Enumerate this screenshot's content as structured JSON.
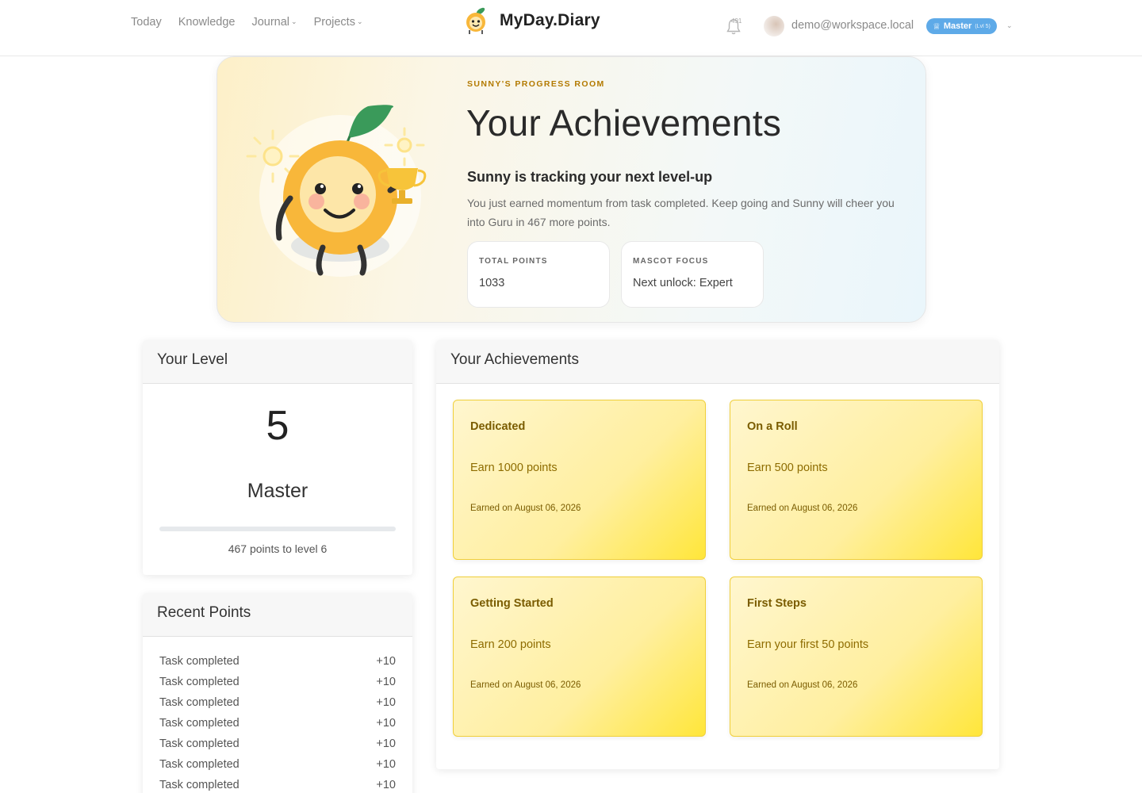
{
  "nav": {
    "links": [
      "Today",
      "Knowledge",
      "Journal",
      "Projects"
    ],
    "brand": "MyDay.Diary",
    "notification_count": "491",
    "user_email": "demo@workspace.local",
    "badge_label": "Master",
    "badge_level": "(Lvl 5)"
  },
  "hero": {
    "eyebrow": "SUNNY'S PROGRESS ROOM",
    "title": "Your Achievements",
    "subtitle": "Sunny is tracking your next level-up",
    "description": "You just earned momentum from task completed. Keep going and Sunny will cheer you into Guru in 467 more points.",
    "stats": [
      {
        "label": "TOTAL POINTS",
        "value": "1033"
      },
      {
        "label": "MASCOT FOCUS",
        "value": "Next unlock: Expert"
      }
    ]
  },
  "level_card": {
    "title": "Your Level",
    "level": "5",
    "name": "Master",
    "progress_fraction": 0.0,
    "note": "467 points to level 6"
  },
  "recent_points": {
    "title": "Recent Points",
    "items": [
      {
        "label": "Task completed",
        "points": "+10"
      },
      {
        "label": "Task completed",
        "points": "+10"
      },
      {
        "label": "Task completed",
        "points": "+10"
      },
      {
        "label": "Task completed",
        "points": "+10"
      },
      {
        "label": "Task completed",
        "points": "+10"
      },
      {
        "label": "Task completed",
        "points": "+10"
      },
      {
        "label": "Task completed",
        "points": "+10"
      }
    ]
  },
  "achievements": {
    "title": "Your Achievements",
    "items": [
      {
        "title": "Dedicated",
        "desc": "Earn 1000 points",
        "date": "Earned on August 06, 2026"
      },
      {
        "title": "On a Roll",
        "desc": "Earn 500 points",
        "date": "Earned on August 06, 2026"
      },
      {
        "title": "Getting Started",
        "desc": "Earn 200 points",
        "date": "Earned on August 06, 2026"
      },
      {
        "title": "First Steps",
        "desc": "Earn your first 50 points",
        "date": "Earned on August 06, 2026"
      }
    ]
  },
  "colors": {
    "accent": "#5eaae8",
    "achievement_text": "#7a5c00",
    "eyebrow": "#b37a00"
  },
  "icons": [
    "bell-icon",
    "trophy-icon",
    "mascot-logo"
  ]
}
